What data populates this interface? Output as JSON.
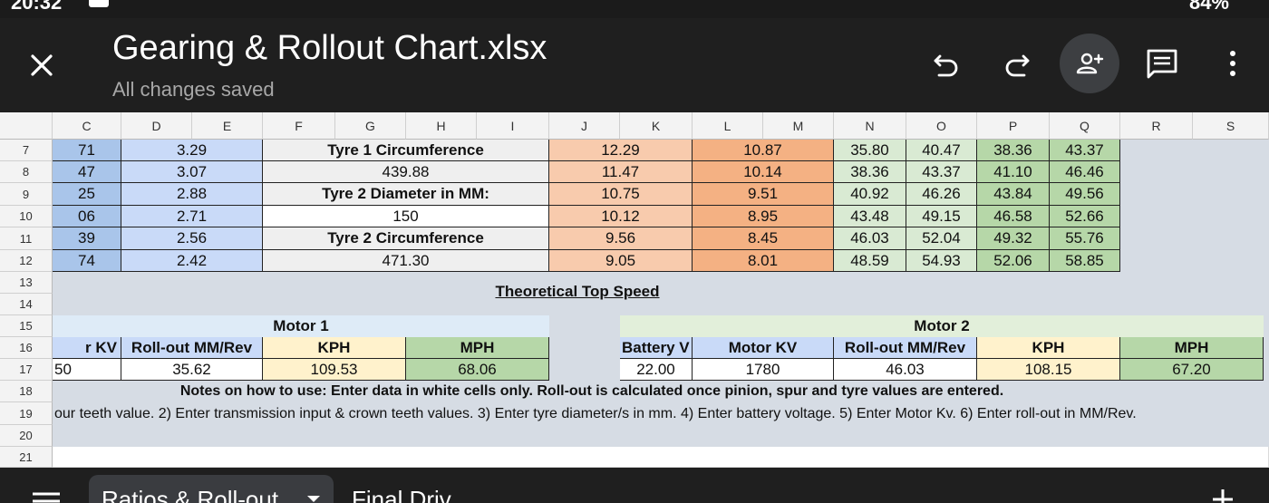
{
  "status": {
    "time": "20:32",
    "battery": "84%"
  },
  "app": {
    "title": "Gearing & Rollout Chart.xlsx",
    "save_status": "All changes saved"
  },
  "icons": {
    "close": "close-icon",
    "undo": "undo-icon",
    "redo": "redo-icon",
    "share": "add-person-icon",
    "comment": "comment-icon",
    "more": "more-vert-icon",
    "menu": "menu-icon",
    "add": "plus-icon",
    "dropdown": "caret-down-icon"
  },
  "colors": {
    "blue_dark": "#a9c5ea",
    "blue_light": "#c9daf8",
    "gray": "#efefef",
    "peach": "#f8cbad",
    "orange": "#f4b183",
    "green_light": "#d9ead3",
    "green": "#b6d7a8",
    "yellow": "#fff2cc",
    "slate": "#d6dce4",
    "motor1_bg": "#deebf7",
    "motor2_bg": "#e2efda"
  },
  "columns": [
    "C",
    "D",
    "E",
    "F",
    "G",
    "H",
    "I",
    "J",
    "K",
    "L",
    "M",
    "N",
    "O",
    "P",
    "Q",
    "R",
    "S"
  ],
  "rows": [
    "7",
    "8",
    "9",
    "10",
    "11",
    "12",
    "13",
    "14",
    "15",
    "16",
    "17",
    "18",
    "19",
    "20",
    "21"
  ],
  "ratios": [
    {
      "c": "71",
      "d": "3.29",
      "label": "Tyre 1 Circumference",
      "j": "12.29",
      "l": "10.87",
      "n": "35.80",
      "o": "40.47",
      "p": "38.36",
      "q": "43.37"
    },
    {
      "c": "47",
      "d": "3.07",
      "label": "439.88",
      "j": "11.47",
      "l": "10.14",
      "n": "38.36",
      "o": "43.37",
      "p": "41.10",
      "q": "46.46"
    },
    {
      "c": "25",
      "d": "2.88",
      "label": "Tyre 2 Diameter in MM:",
      "j": "10.75",
      "l": "9.51",
      "n": "40.92",
      "o": "46.26",
      "p": "43.84",
      "q": "49.56"
    },
    {
      "c": "06",
      "d": "2.71",
      "label": "150",
      "j": "10.12",
      "l": "8.95",
      "n": "43.48",
      "o": "49.15",
      "p": "46.58",
      "q": "52.66"
    },
    {
      "c": "39",
      "d": "2.56",
      "label": "Tyre 2 Circumference",
      "j": "9.56",
      "l": "8.45",
      "n": "46.03",
      "o": "52.04",
      "p": "49.32",
      "q": "55.76"
    },
    {
      "c": "74",
      "d": "2.42",
      "label": "471.30",
      "j": "9.05",
      "l": "8.01",
      "n": "48.59",
      "o": "54.93",
      "p": "52.06",
      "q": "58.85"
    }
  ],
  "speed_title": "Theoretical Top Speed",
  "motor1": {
    "title": "Motor 1",
    "headers": [
      "r KV",
      "Roll-out MM/Rev",
      "KPH",
      "MPH"
    ],
    "values": [
      "50",
      "35.62",
      "109.53",
      "68.06"
    ]
  },
  "motor2": {
    "title": "Motor 2",
    "headers": [
      "Battery V",
      "Motor KV",
      "Roll-out MM/Rev",
      "KPH",
      "MPH"
    ],
    "values": [
      "22.00",
      "1780",
      "46.03",
      "108.15",
      "67.20"
    ]
  },
  "notes": {
    "line1": "Notes on how to use:  Enter data in white cells only.  Roll-out is calculated once pinion, spur and tyre values are entered.",
    "line2": "our teeth value. 2) Enter transmission input & crown teeth values. 3) Enter tyre diameter/s in mm. 4) Enter battery voltage. 5) Enter Motor Kv. 6) Enter roll-out in MM/Rev."
  },
  "tabs": [
    {
      "label": "Ratios & Roll-out"
    },
    {
      "label": "Final Driv"
    }
  ]
}
